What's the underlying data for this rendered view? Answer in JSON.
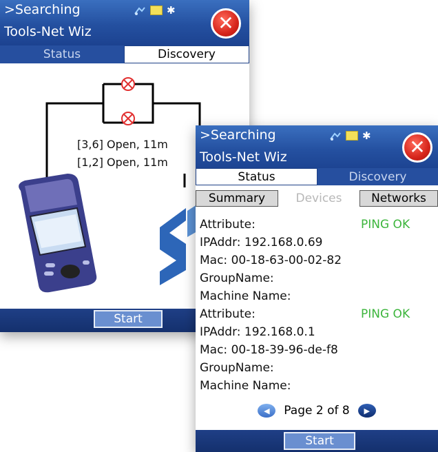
{
  "back_window": {
    "title_line1": ">Searching",
    "title_line2": "Tools-Net Wiz",
    "tabs": [
      "Status",
      "Discovery"
    ],
    "active_tab": "Discovery",
    "pairs": [
      "[3,6] Open, 11m",
      "[1,2] Open, 11m"
    ],
    "start_label": "Start"
  },
  "front_window": {
    "title_line1": ">Searching",
    "title_line2": "Tools-Net Wiz",
    "tabs": [
      "Status",
      "Discovery"
    ],
    "active_tab": "Status",
    "subtabs": [
      "Summary",
      "Devices",
      "Networks"
    ],
    "active_subtab": "Devices",
    "devices": [
      {
        "attribute_label": "Attribute:",
        "attribute_value": "PING OK",
        "ip": "IPAddr:  192.168.0.69",
        "mac": "Mac:  00-18-63-00-02-82",
        "group": "GroupName:",
        "machine": "Machine Name:"
      },
      {
        "attribute_label": "Attribute:",
        "attribute_value": "PING OK",
        "ip": "IPAddr:  192.168.0.1",
        "mac": "Mac:  00-18-39-96-de-f8",
        "group": "GroupName:",
        "machine": "Machine Name:"
      }
    ],
    "page_text": "Page 2 of 8",
    "start_label": "Start"
  },
  "icons": {
    "network": "network-icon",
    "folder": "folder-icon",
    "bluetooth": "bluetooth-icon",
    "close": "close-icon",
    "lamp": "lamp-icon",
    "prev": "prev-page-icon",
    "next": "next-page-icon"
  },
  "colors": {
    "titlebar": "#2450a0",
    "close": "#d6251b",
    "ping_ok": "#3cb53c",
    "start_button": "#6a8fd0"
  }
}
